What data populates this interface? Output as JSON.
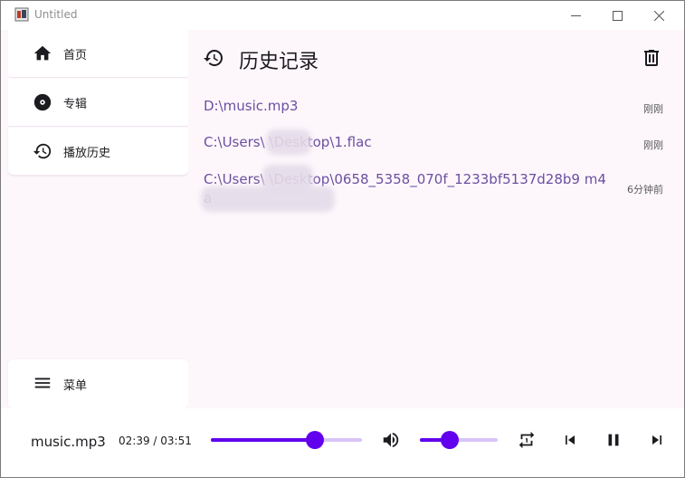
{
  "window": {
    "title": "Untitled"
  },
  "sidebar": {
    "items": [
      {
        "label": "首页",
        "icon": "home-icon"
      },
      {
        "label": "专辑",
        "icon": "album-icon"
      },
      {
        "label": "播放历史",
        "icon": "history-icon"
      }
    ],
    "menu": {
      "label": "菜单",
      "icon": "menu-icon"
    }
  },
  "main": {
    "title": "历史记录",
    "header_icon": "history-icon",
    "action_icon": "delete-icon",
    "history": [
      {
        "path": "D:\\music.mp3",
        "time": "刚刚"
      },
      {
        "path": "C:\\Users\\        \\Desktop\\1.flac",
        "time": "刚刚"
      },
      {
        "path": "C:\\Users\\        \\Desktop\\0658_5358_070f_1233bf5137d28b9                                   m4a",
        "time": "6分钟前"
      }
    ]
  },
  "player": {
    "track_name": "music.mp3",
    "time_display": "02:39 / 03:51",
    "progress": 0.69,
    "volume": 0.38,
    "accent_color": "#6200ee",
    "track_color": "#d9c4f7",
    "icons": [
      "volume-icon",
      "repeat-icon",
      "previous-icon",
      "pause-icon",
      "next-icon"
    ]
  }
}
